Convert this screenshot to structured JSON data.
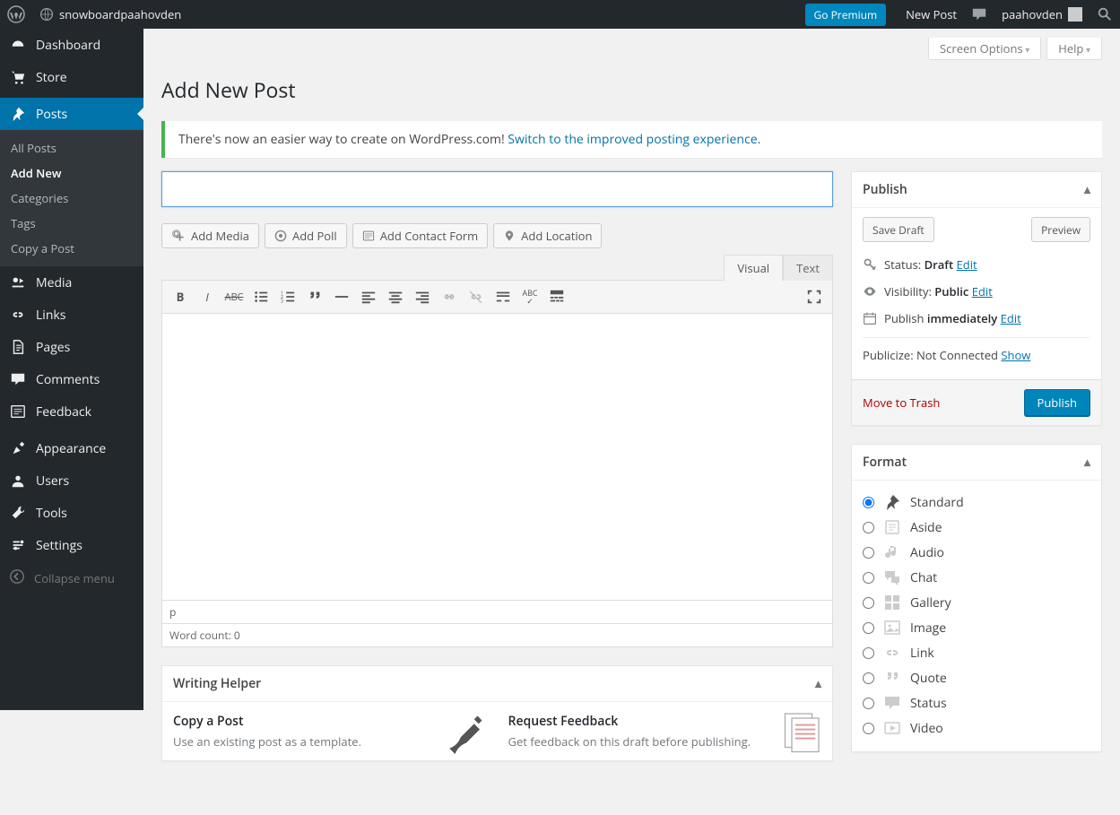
{
  "adminbar": {
    "site_name": "snowboardpaahovden",
    "go_premium": "Go Premium",
    "new_post": "New Post",
    "username": "paahovden"
  },
  "sidebar": {
    "items": [
      {
        "label": "Dashboard",
        "icon": "dashboard"
      },
      {
        "label": "Store",
        "icon": "cart"
      },
      {
        "label": "Posts",
        "icon": "pin",
        "current": true
      },
      {
        "label": "Media",
        "icon": "media"
      },
      {
        "label": "Links",
        "icon": "links"
      },
      {
        "label": "Pages",
        "icon": "pages"
      },
      {
        "label": "Comments",
        "icon": "comments"
      },
      {
        "label": "Feedback",
        "icon": "feedback"
      },
      {
        "label": "Appearance",
        "icon": "appearance"
      },
      {
        "label": "Users",
        "icon": "users"
      },
      {
        "label": "Tools",
        "icon": "tools"
      },
      {
        "label": "Settings",
        "icon": "settings"
      }
    ],
    "submenu": [
      {
        "label": "All Posts"
      },
      {
        "label": "Add New",
        "current": true
      },
      {
        "label": "Categories"
      },
      {
        "label": "Tags"
      },
      {
        "label": "Copy a Post"
      }
    ],
    "collapse": "Collapse menu"
  },
  "screen_meta": {
    "screen_options": "Screen Options",
    "help": "Help"
  },
  "page_title": "Add New Post",
  "notice": {
    "text": "There's now an easier way to create on WordPress.com! ",
    "link": "Switch to the improved posting experience",
    "suffix": "."
  },
  "media_buttons": {
    "add_media": "Add Media",
    "add_poll": "Add Poll",
    "add_contact_form": "Add Contact Form",
    "add_location": "Add Location"
  },
  "editor": {
    "tab_visual": "Visual",
    "tab_text": "Text",
    "path": "p",
    "word_count_label": "Word count: ",
    "word_count": "0"
  },
  "publish": {
    "title": "Publish",
    "save_draft": "Save Draft",
    "preview": "Preview",
    "status_label": "Status: ",
    "status_value": "Draft",
    "visibility_label": "Visibility: ",
    "visibility_value": "Public",
    "publish_label": "Publish ",
    "publish_value": "immediately",
    "edit": "Edit",
    "publicize_label": "Publicize: ",
    "publicize_value": "Not Connected ",
    "publicize_link": "Show",
    "trash": "Move to Trash",
    "publish_button": "Publish"
  },
  "format": {
    "title": "Format",
    "items": [
      {
        "label": "Standard",
        "value": "standard",
        "checked": true
      },
      {
        "label": "Aside",
        "value": "aside"
      },
      {
        "label": "Audio",
        "value": "audio"
      },
      {
        "label": "Chat",
        "value": "chat"
      },
      {
        "label": "Gallery",
        "value": "gallery"
      },
      {
        "label": "Image",
        "value": "image"
      },
      {
        "label": "Link",
        "value": "link"
      },
      {
        "label": "Quote",
        "value": "quote"
      },
      {
        "label": "Status",
        "value": "status"
      },
      {
        "label": "Video",
        "value": "video"
      }
    ]
  },
  "helper": {
    "title": "Writing Helper",
    "copy": {
      "title": "Copy a Post",
      "desc": "Use an existing post as a template."
    },
    "feedback": {
      "title": "Request Feedback",
      "desc": "Get feedback on this draft before publishing."
    }
  }
}
